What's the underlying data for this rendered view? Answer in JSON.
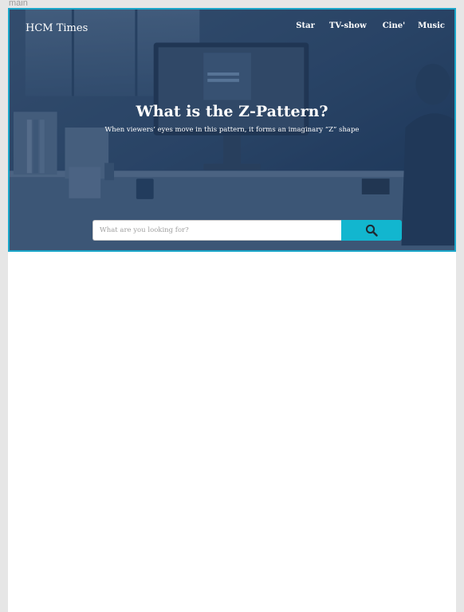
{
  "frame": {
    "label": "main"
  },
  "header": {
    "logo": "HCM Times",
    "nav": [
      {
        "label": "Star"
      },
      {
        "label": "TV-show"
      },
      {
        "label": "Cine'"
      },
      {
        "label": "Music"
      }
    ]
  },
  "hero": {
    "title": "What is the Z-Pattern?",
    "subtitle": "When viewers’ eyes move in this pattern, it forms an imaginary “Z” shape"
  },
  "search": {
    "placeholder": "What are you looking for?",
    "value": "",
    "button_icon": "search-icon"
  },
  "colors": {
    "accent": "#12b6cf",
    "frame_border": "#1aa6c9",
    "hero_overlay": "#223a58"
  }
}
